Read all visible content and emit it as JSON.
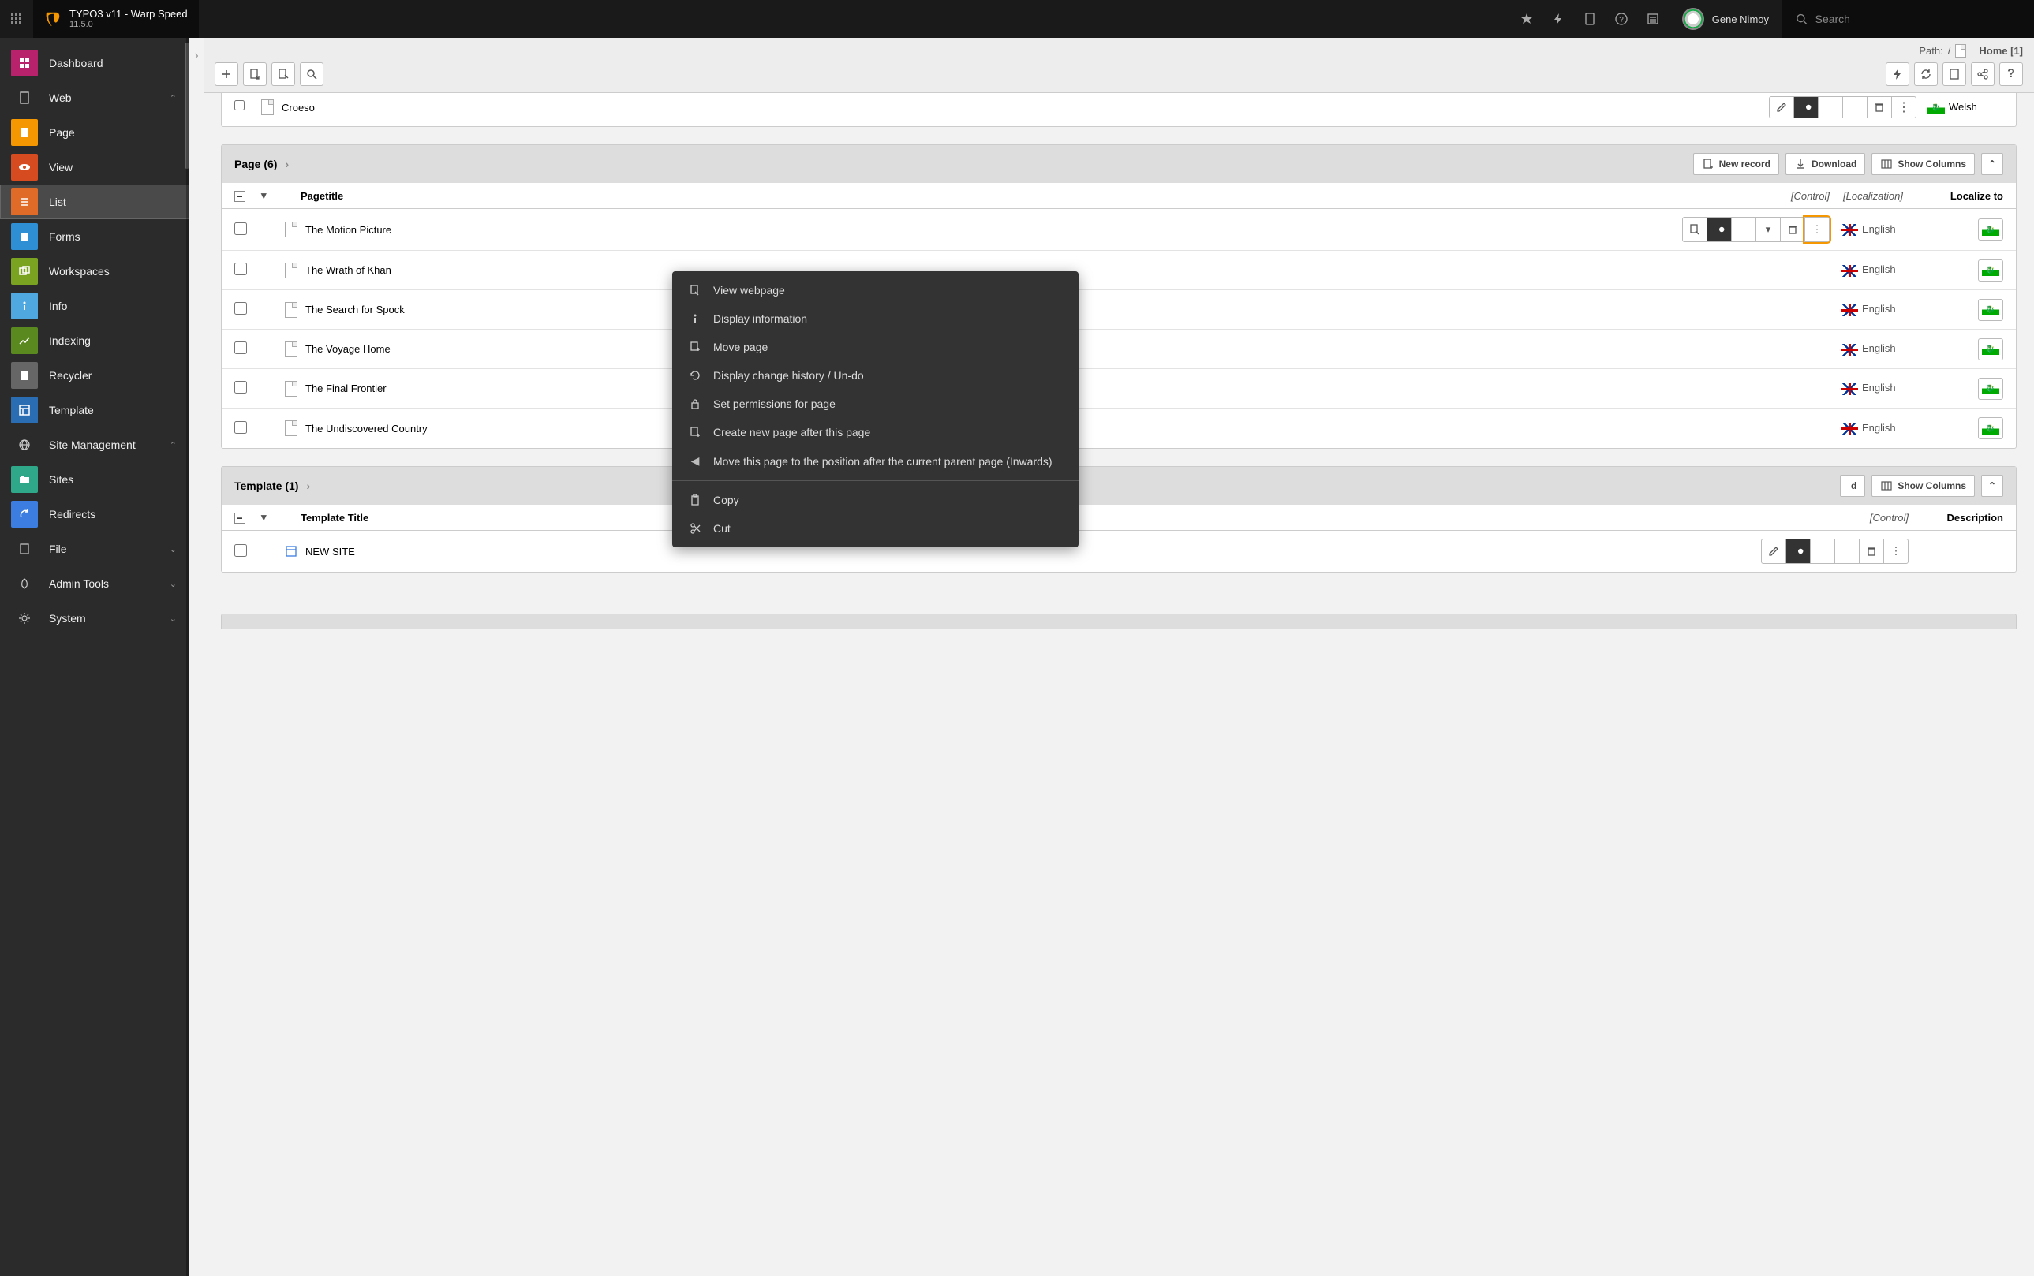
{
  "topbar": {
    "title": "TYPO3 v11 - Warp Speed",
    "version": "11.5.0",
    "user": "Gene Nimoy",
    "search_placeholder": "Search"
  },
  "modules": {
    "dashboard": "Dashboard",
    "web": "Web",
    "page": "Page",
    "view": "View",
    "list": "List",
    "forms": "Forms",
    "workspaces": "Workspaces",
    "info": "Info",
    "indexing": "Indexing",
    "recycler": "Recycler",
    "template": "Template",
    "site_management": "Site Management",
    "sites": "Sites",
    "redirects": "Redirects",
    "file": "File",
    "admin_tools": "Admin Tools",
    "system": "System"
  },
  "docheader": {
    "path_label": "Path:",
    "path_sep": "/",
    "page": "Home [1]"
  },
  "stub_row": {
    "title": "Croeso",
    "lang_label": "Welsh"
  },
  "panel_page": {
    "title": "Page (6)",
    "btn_new": "New record",
    "btn_download": "Download",
    "btn_cols": "Show Columns",
    "col_title": "Pagetitle",
    "col_control": "[Control]",
    "col_localization": "[Localization]",
    "col_localize": "Localize to",
    "rows": [
      {
        "title": "The Motion Picture",
        "lang": "English"
      },
      {
        "title": "The Wrath of Khan",
        "lang": "English"
      },
      {
        "title": "The Search for Spock",
        "lang": "English"
      },
      {
        "title": "The Voyage Home",
        "lang": "English"
      },
      {
        "title": "The Final Frontier",
        "lang": "English"
      },
      {
        "title": "The Undiscovered Country",
        "lang": "English"
      }
    ]
  },
  "panel_template": {
    "title": "Template (1)",
    "btn_cols": "Show Columns",
    "col_title": "Template Title",
    "col_control": "[Control]",
    "col_desc": "Description",
    "rows": [
      {
        "title": "NEW SITE"
      }
    ]
  },
  "context_menu": {
    "view": "View webpage",
    "info": "Display information",
    "move": "Move page",
    "history": "Display change history / Un-do",
    "perms": "Set permissions for page",
    "create_after": "Create new page after this page",
    "move_inwards": "Move this page to the position after the current parent page (Inwards)",
    "copy": "Copy",
    "cut": "Cut"
  }
}
